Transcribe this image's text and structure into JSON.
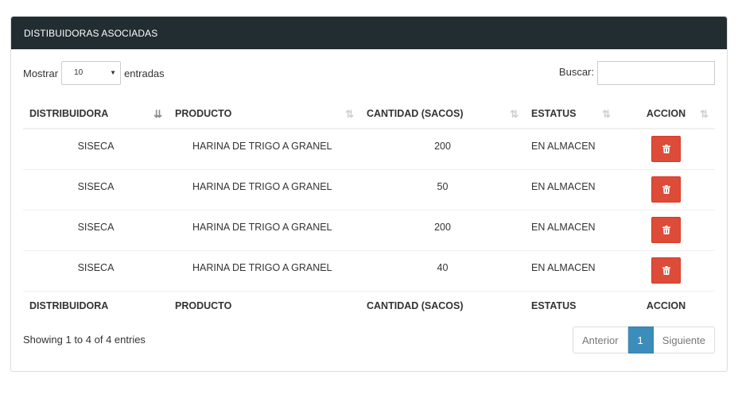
{
  "panel": {
    "title": "DISTIBUIDORAS ASOCIADAS"
  },
  "controls": {
    "length_prefix": "Mostrar",
    "length_value": "10",
    "length_suffix": "entradas",
    "search_label": "Buscar:",
    "search_value": ""
  },
  "table": {
    "headers": [
      "DISTRIBUIDORA",
      "PRODUCTO",
      "CANTIDAD (SACOS)",
      "ESTATUS",
      "ACCION"
    ],
    "rows": [
      [
        "SISECA",
        "HARINA DE TRIGO A GRANEL",
        "200",
        "EN ALMACEN"
      ],
      [
        "SISECA",
        "HARINA DE TRIGO A GRANEL",
        "50",
        "EN ALMACEN"
      ],
      [
        "SISECA",
        "HARINA DE TRIGO A GRANEL",
        "200",
        "EN ALMACEN"
      ],
      [
        "SISECA",
        "HARINA DE TRIGO A GRANEL",
        "40",
        "EN ALMACEN"
      ]
    ],
    "footers": [
      "DISTRIBUIDORA",
      "PRODUCTO",
      "CANTIDAD (SACOS)",
      "ESTATUS",
      "ACCION"
    ],
    "delete_icon": "trash-icon",
    "delete_color": "#dd4b39"
  },
  "info": "Showing 1 to 4 of 4 entries",
  "pagination": {
    "prev": "Anterior",
    "current": "1",
    "next": "Siguiente"
  },
  "colors": {
    "header_bg": "#222d32",
    "accent": "#3c8dbc"
  }
}
